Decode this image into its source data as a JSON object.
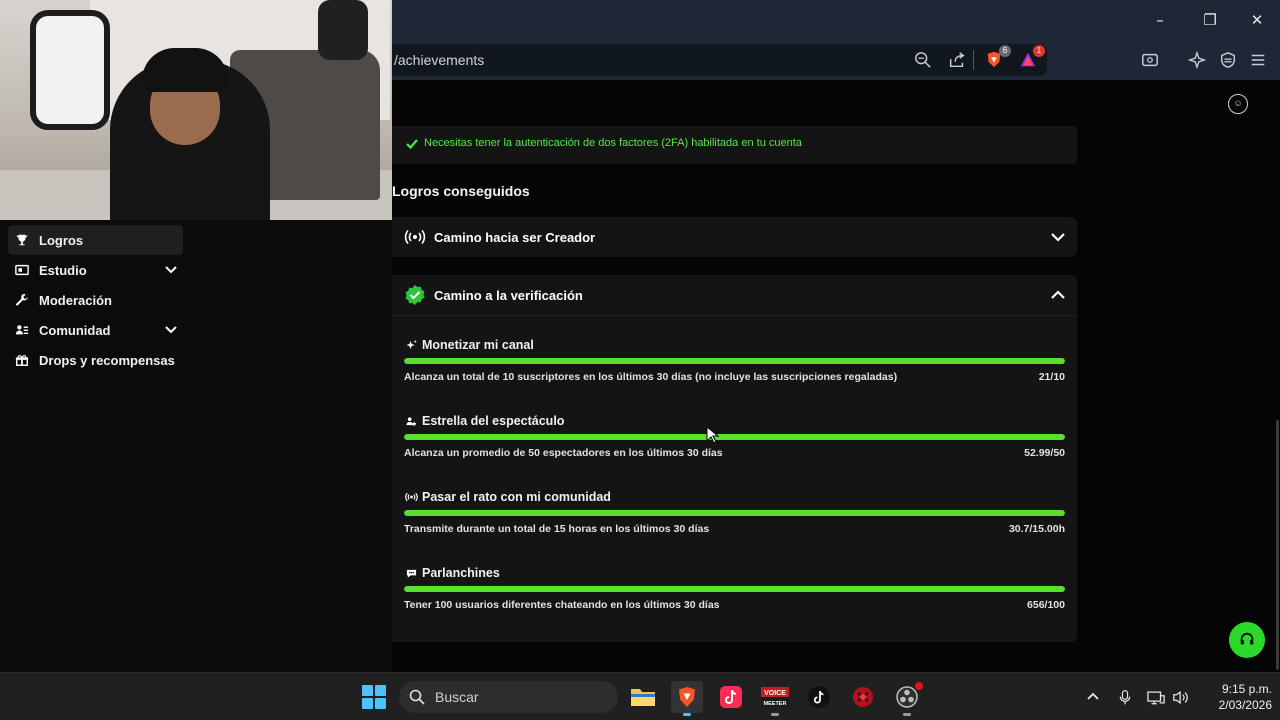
{
  "browser": {
    "url_fragment": "/achievements",
    "brave_badge": "6",
    "rewards_badge": "1"
  },
  "sidebar": {
    "items": [
      {
        "label": "Logros",
        "icon": "trophy-icon",
        "active": true
      },
      {
        "label": "Estudio",
        "icon": "studio-icon",
        "expandable": true
      },
      {
        "label": "Moderación",
        "icon": "wrench-icon"
      },
      {
        "label": "Comunidad",
        "icon": "community-icon",
        "expandable": true
      },
      {
        "label": "Drops y recompensas",
        "icon": "gift-icon"
      }
    ]
  },
  "main": {
    "requirement_2fa": "Necesitas tener la autenticación de dos factores (2FA) habilitada en tu cuenta",
    "section_title": "Logros conseguidos",
    "accordions": [
      {
        "title": "Camino hacia ser Creador",
        "icon": "broadcast-icon",
        "expanded": false
      },
      {
        "title": "Camino a la verificación",
        "icon": "verified-badge-icon",
        "expanded": true
      }
    ],
    "achievements": [
      {
        "title": "Monetizar mi canal",
        "icon": "sparkle-icon",
        "description": "Alcanza un total de 10 suscriptores en los últimos 30 días (no incluye las suscripciones regaladas)",
        "value": "21/10",
        "progress": 1.0
      },
      {
        "title": "Estrella del espectáculo",
        "icon": "viewers-icon",
        "description": "Alcanza un promedio de 50 espectadores en los últimos 30 días",
        "value": "52.99/50",
        "progress": 1.0
      },
      {
        "title": "Pasar el rato con mi comunidad",
        "icon": "broadcast-icon",
        "description": "Transmite durante un total de 15 horas en los últimos 30 días",
        "value": "30.7/15.00h",
        "progress": 1.0
      },
      {
        "title": "Parlanchines",
        "icon": "chat-icon",
        "description": "Tener 100 usuarios diferentes chateando en los últimos 30 días",
        "value": "656/100",
        "progress": 1.0
      }
    ]
  },
  "taskbar": {
    "search_placeholder": "Buscar",
    "time": "9:15 p.m.",
    "date": "2/03/2026",
    "voicemeeter_label_top": "VOICE",
    "voicemeeter_label_bottom": "MEETER"
  },
  "colors": {
    "accent_green": "#58e02c",
    "text_green": "#57e54a",
    "toolbar_bg": "#1d2735"
  }
}
